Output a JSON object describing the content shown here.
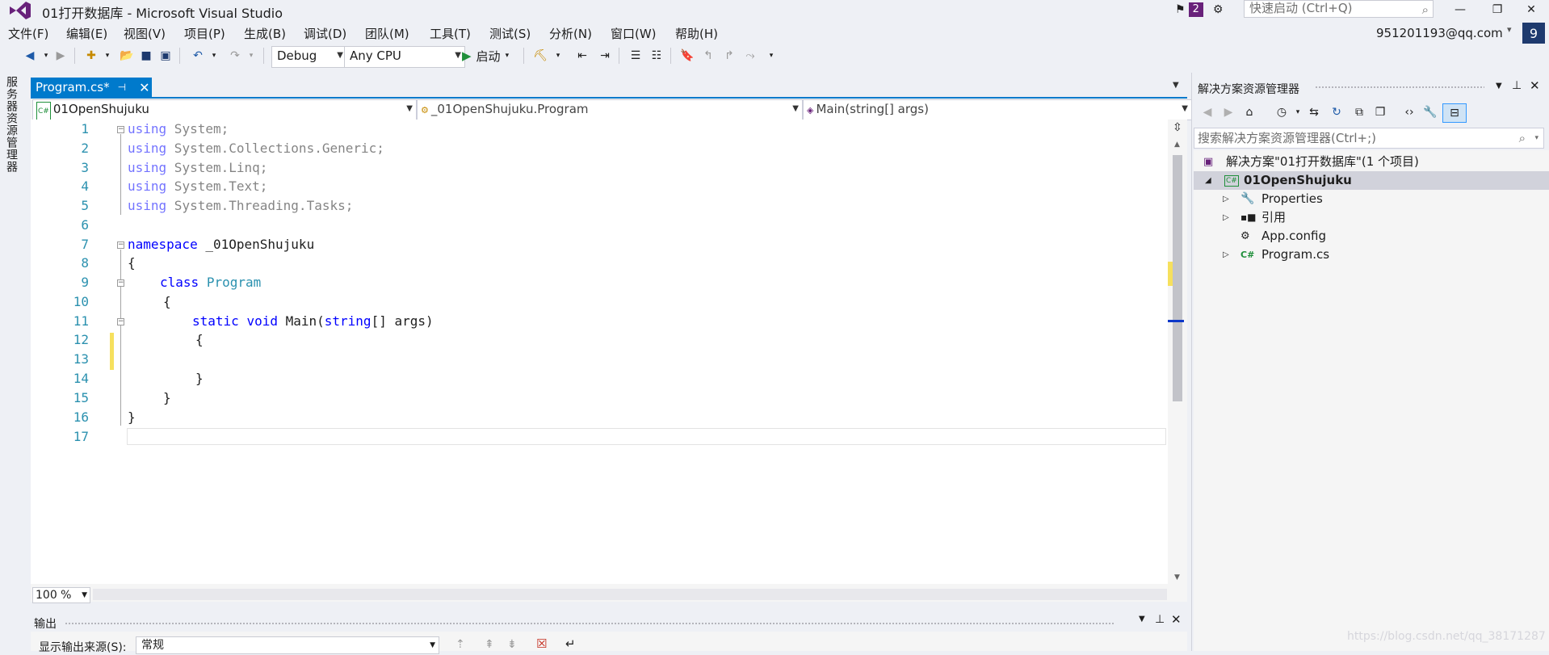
{
  "window": {
    "title": "01打开数据库 - Microsoft Visual Studio",
    "notification_count": "2",
    "quick_launch_placeholder": "快速启动 (Ctrl+Q)",
    "minimize": "—",
    "restore": "❐",
    "close": "✕"
  },
  "menu": [
    "文件(F)",
    "编辑(E)",
    "视图(V)",
    "项目(P)",
    "生成(B)",
    "调试(D)",
    "团队(M)",
    "工具(T)",
    "测试(S)",
    "分析(N)",
    "窗口(W)",
    "帮助(H)"
  ],
  "account": {
    "email": "951201193@qq.com",
    "badge": "9"
  },
  "toolbar": {
    "config": "Debug",
    "platform": "Any CPU",
    "start_label": "启动"
  },
  "left_tab": "服务器资源管理器",
  "document_tab": {
    "label": "Program.cs*"
  },
  "nav": {
    "project": "01OpenShujuku",
    "class": "_01OpenShujuku.Program",
    "member": "Main(string[] args)"
  },
  "code": {
    "line_numbers": [
      "1",
      "2",
      "3",
      "4",
      "5",
      "6",
      "7",
      "8",
      "9",
      "10",
      "11",
      "12",
      "13",
      "14",
      "15",
      "16",
      "17"
    ],
    "using1": "using",
    "using1_rest": " System;",
    "using2": "using",
    "using2_rest": " System.Collections.Generic;",
    "using3": "using",
    "using3_rest": " System.Linq;",
    "using4": "using",
    "using4_rest": " System.Text;",
    "using5": "using",
    "using5_rest": " System.Threading.Tasks;",
    "namespace_kw": "namespace",
    "namespace_name": " _01OpenShujuku",
    "brace_open": "{",
    "brace_close": "}",
    "class_kw": "class",
    "class_name": "Program",
    "static_kw": "static",
    "void_kw": "void",
    "main_name": " Main(",
    "string_kw": "string",
    "main_rest": "[] args)"
  },
  "zoom": "100 %",
  "output": {
    "title": "输出",
    "source_label": "显示输出来源(S):",
    "source_value": "常规"
  },
  "solution_explorer": {
    "title": "解决方案资源管理器",
    "search_placeholder": "搜索解决方案资源管理器(Ctrl+;)",
    "tree": [
      {
        "label": "解决方案\"01打开数据库\"(1 个项目)",
        "icon": "solution-icon"
      },
      {
        "label": "01OpenShujuku",
        "icon": "csharp-project-icon"
      },
      {
        "label": "Properties",
        "icon": "wrench-icon"
      },
      {
        "label": "引用",
        "icon": "references-icon"
      },
      {
        "label": "App.config",
        "icon": "config-icon"
      },
      {
        "label": "Program.cs",
        "icon": "csharp-file-icon"
      }
    ]
  },
  "watermark": "https://blog.csdn.net/qq_38171287",
  "colors": {
    "accent": "#007acc",
    "keyword": "#0000ff",
    "type": "#2b91af",
    "vs_purple": "#68217a"
  }
}
